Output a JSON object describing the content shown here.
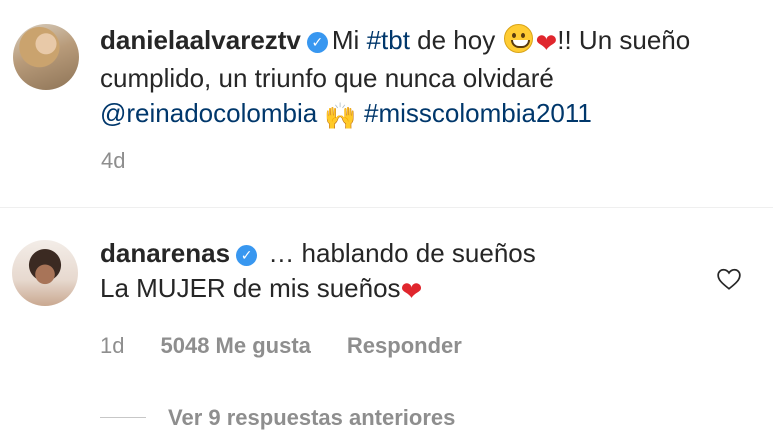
{
  "post": {
    "username": "danielaalvareztv",
    "caption_start": "Mi ",
    "hashtag1": "#tbt",
    "caption_mid": " de hoy ",
    "caption_after_emojis": "!! Un sueño cumplido, un triunfo que nunca olvidaré ",
    "mention": "@reinadocolombia",
    "hashtag2": "#misscolombia2011",
    "time": "4d"
  },
  "comment": {
    "username": "danarenas",
    "text_line1": "… hablando de sueños",
    "text_line2": "La MUJER de mis sueños",
    "time": "1d",
    "likes": "5048 Me gusta",
    "reply_label": "Responder"
  },
  "replies": {
    "label": "Ver 9 respuestas anteriores"
  },
  "icons": {
    "verified": "verified-badge-icon",
    "like": "heart-outline-icon"
  },
  "colors": {
    "link": "#00376b",
    "verified": "#3897f0",
    "muted": "#8e8e8e"
  }
}
